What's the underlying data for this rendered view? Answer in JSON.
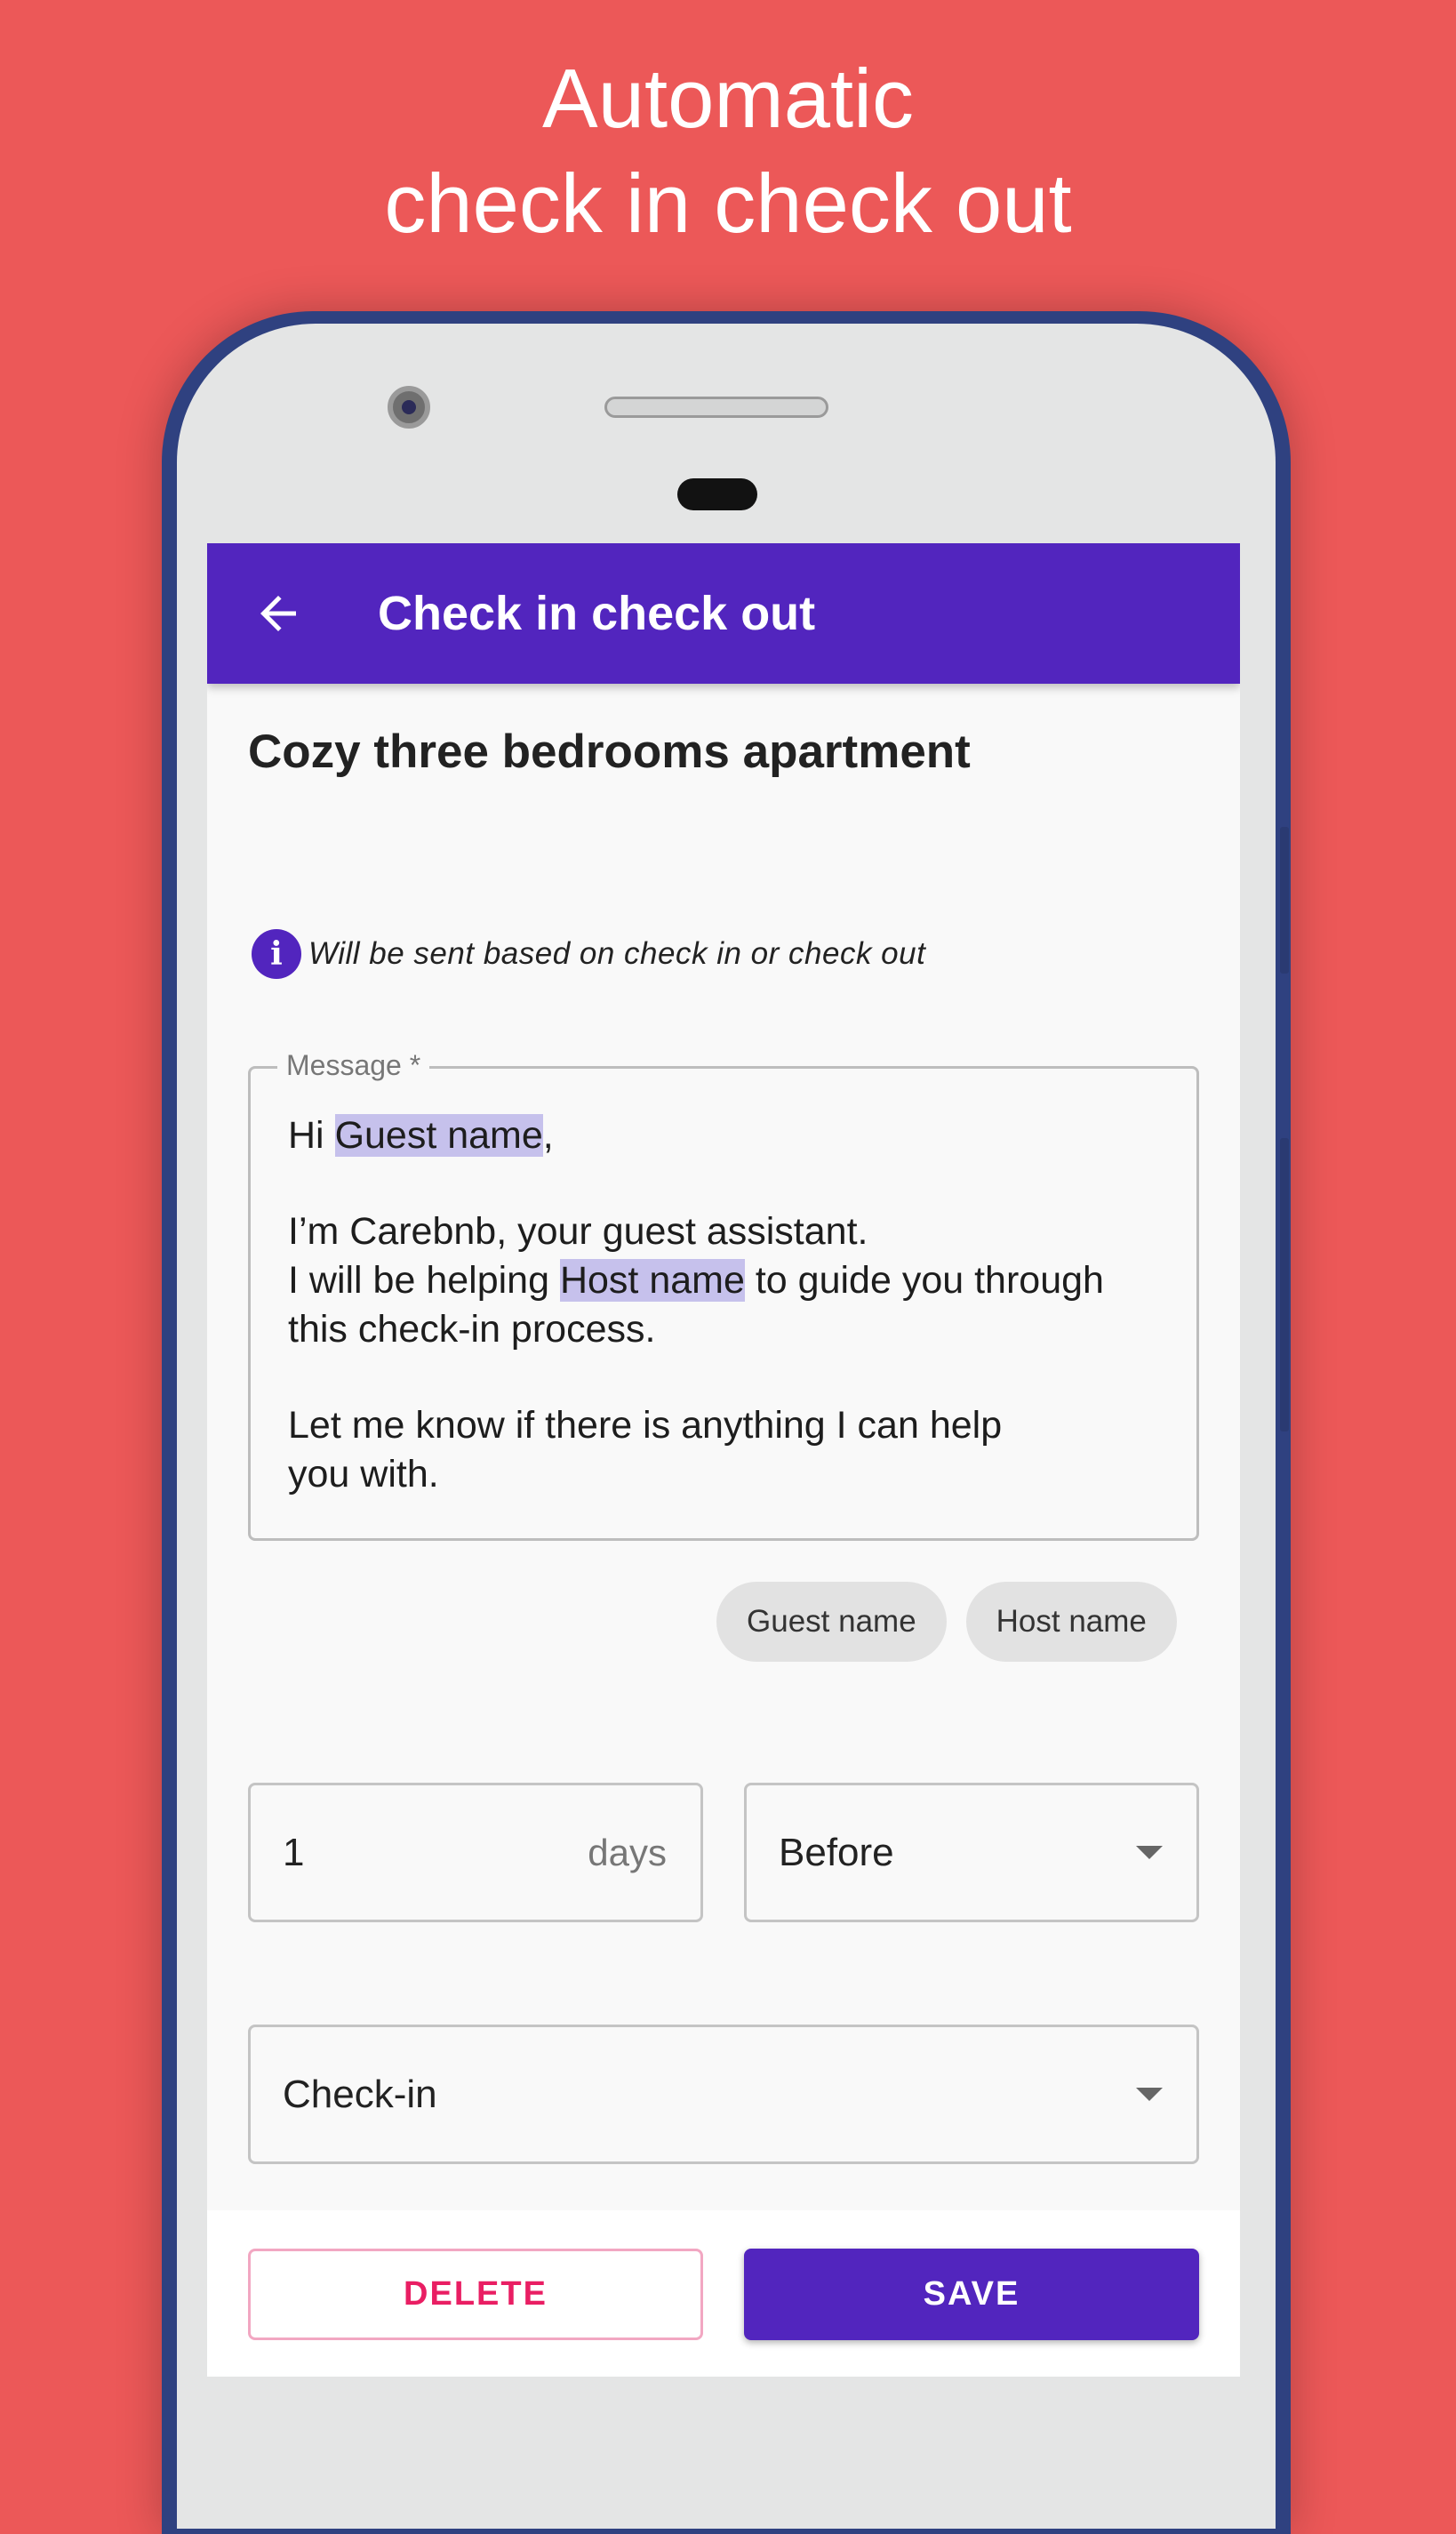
{
  "headline": {
    "line1": "Automatic",
    "line2": "check in check out"
  },
  "app_bar": {
    "title": "Check in check out",
    "back_icon": "arrow-left-icon"
  },
  "listing": {
    "title": "Cozy three bedrooms apartment"
  },
  "info": {
    "icon": "info-icon",
    "text": "Will be sent based on check in or check out"
  },
  "message": {
    "label": "Message *",
    "greeting_prefix": "Hi ",
    "guest_placeholder": "Guest name",
    "greeting_suffix": ",",
    "line_intro": "I’m Carebnb, your guest assistant.",
    "helping_prefix": "I will be helping ",
    "host_placeholder": "Host name",
    "helping_suffix": " to guide you through",
    "line_process": "this check-in process.",
    "line_help_1": "Let me know if there is anything I can help",
    "line_help_2": "you with."
  },
  "chips": {
    "guest": "Guest name",
    "host": "Host name"
  },
  "schedule": {
    "days_value": "1",
    "days_suffix": "days",
    "timing": "Before",
    "event": "Check-in"
  },
  "actions": {
    "delete": "DELETE",
    "save": "SAVE"
  },
  "colors": {
    "background": "#ec5858",
    "primary": "#5225be",
    "highlight": "#c6c1ec",
    "delete": "#e91e63"
  }
}
